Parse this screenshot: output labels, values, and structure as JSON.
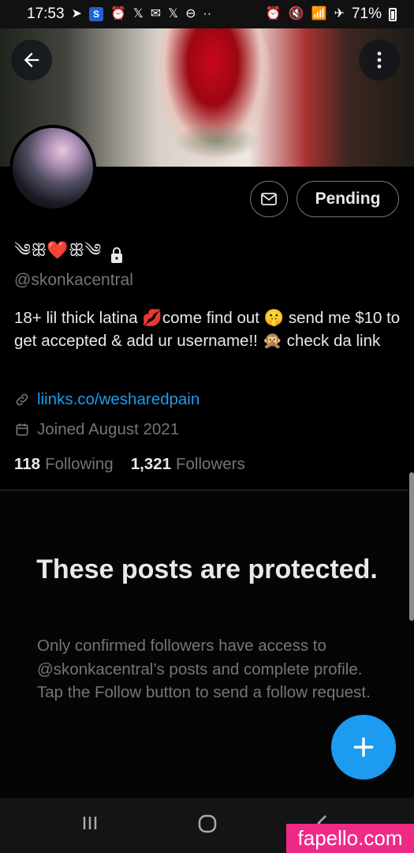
{
  "status_bar": {
    "time": "17:53",
    "left_icons": [
      "telegram-icon",
      "s-app-icon",
      "alarm-icon",
      "x-icon",
      "gmail-icon",
      "x-icon",
      "do-not-disturb-icon",
      "more-dots-icon"
    ],
    "badge_letter": "S",
    "right_icons": [
      "alarm-icon",
      "mute-icon",
      "wifi-icon",
      "airplane-icon",
      "battery-icon"
    ],
    "battery": "71%"
  },
  "profile": {
    "display_name": "༄ꕥ❤️ꕥ༄",
    "locked_icon": "lock-icon",
    "handle": "@skonkacentral",
    "bio": "18+ lil thick latina 💋come find out 🤫 send me $10 to get accepted & add ur username!! 🙊 check da link",
    "link": "liinks.co/wesharedpain",
    "joined": "Joined August 2021",
    "following_count": "118",
    "following_label": "Following",
    "followers_count": "1,321",
    "followers_label": "Followers"
  },
  "actions": {
    "pending_label": "Pending",
    "message_icon": "mail-icon"
  },
  "protected": {
    "title": "These posts are protected.",
    "body": "Only confirmed followers have access to @skonkacentral’s posts and complete profile. Tap the Follow button to send a follow request."
  },
  "watermark": "fapello.com",
  "colors": {
    "accent": "#1d9bf0",
    "background": "#000000",
    "muted_text": "#71767b",
    "watermark": "#ee2a86"
  }
}
